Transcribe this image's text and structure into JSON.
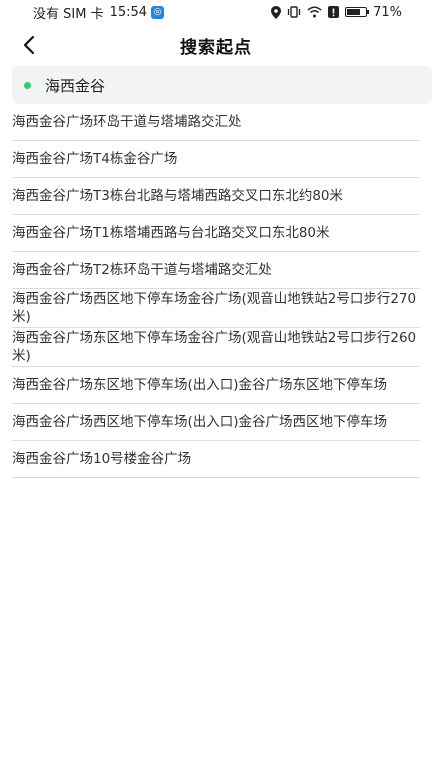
{
  "status_bar": {
    "carrier": "没有 SIM 卡",
    "time": "15:54",
    "battery_text": "71%",
    "battery_level": 0.71
  },
  "header": {
    "title": "搜索起点"
  },
  "search": {
    "value": "海西金谷"
  },
  "results": [
    "海西金谷广场环岛干道与塔埔路交汇处",
    "海西金谷广场T4栋金谷广场",
    "海西金谷广场T3栋台北路与塔埔西路交叉口东北约80米",
    "海西金谷广场T1栋塔埔西路与台北路交叉口东北80米",
    "海西金谷广场T2栋环岛干道与塔埔路交汇处",
    "海西金谷广场西区地下停车场金谷广场(观音山地铁站2号口步行270米)",
    "海西金谷广场东区地下停车场金谷广场(观音山地铁站2号口步行260米)",
    "海西金谷广场东区地下停车场(出入口)金谷广场东区地下停车场",
    "海西金谷广场西区地下停车场(出入口)金谷广场西区地下停车场",
    "海西金谷广场10号楼金谷广场"
  ],
  "colors": {
    "accent_dot": "#2ecc71",
    "search_bg": "#f2f3f5",
    "divider": "#dcdcdc"
  }
}
